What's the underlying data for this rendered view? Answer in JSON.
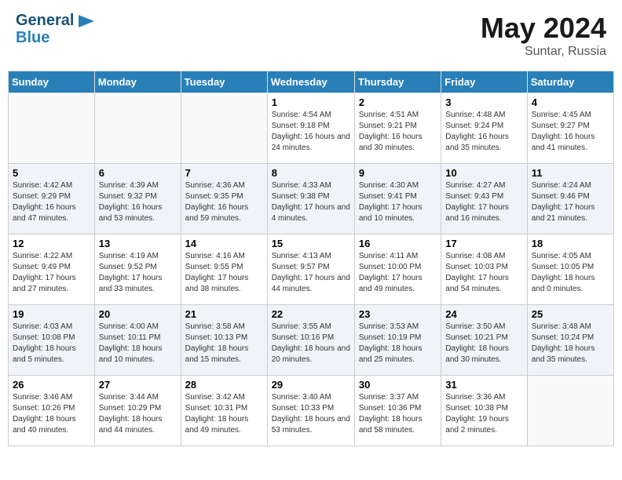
{
  "header": {
    "logo_line1": "General",
    "logo_line2": "Blue",
    "month": "May 2024",
    "location": "Suntar, Russia"
  },
  "days_of_week": [
    "Sunday",
    "Monday",
    "Tuesday",
    "Wednesday",
    "Thursday",
    "Friday",
    "Saturday"
  ],
  "weeks": [
    [
      {
        "num": "",
        "info": ""
      },
      {
        "num": "",
        "info": ""
      },
      {
        "num": "",
        "info": ""
      },
      {
        "num": "1",
        "info": "Sunrise: 4:54 AM\nSunset: 9:18 PM\nDaylight: 16 hours\nand 24 minutes."
      },
      {
        "num": "2",
        "info": "Sunrise: 4:51 AM\nSunset: 9:21 PM\nDaylight: 16 hours\nand 30 minutes."
      },
      {
        "num": "3",
        "info": "Sunrise: 4:48 AM\nSunset: 9:24 PM\nDaylight: 16 hours\nand 35 minutes."
      },
      {
        "num": "4",
        "info": "Sunrise: 4:45 AM\nSunset: 9:27 PM\nDaylight: 16 hours\nand 41 minutes."
      }
    ],
    [
      {
        "num": "5",
        "info": "Sunrise: 4:42 AM\nSunset: 9:29 PM\nDaylight: 16 hours\nand 47 minutes."
      },
      {
        "num": "6",
        "info": "Sunrise: 4:39 AM\nSunset: 9:32 PM\nDaylight: 16 hours\nand 53 minutes."
      },
      {
        "num": "7",
        "info": "Sunrise: 4:36 AM\nSunset: 9:35 PM\nDaylight: 16 hours\nand 59 minutes."
      },
      {
        "num": "8",
        "info": "Sunrise: 4:33 AM\nSunset: 9:38 PM\nDaylight: 17 hours\nand 4 minutes."
      },
      {
        "num": "9",
        "info": "Sunrise: 4:30 AM\nSunset: 9:41 PM\nDaylight: 17 hours\nand 10 minutes."
      },
      {
        "num": "10",
        "info": "Sunrise: 4:27 AM\nSunset: 9:43 PM\nDaylight: 17 hours\nand 16 minutes."
      },
      {
        "num": "11",
        "info": "Sunrise: 4:24 AM\nSunset: 9:46 PM\nDaylight: 17 hours\nand 21 minutes."
      }
    ],
    [
      {
        "num": "12",
        "info": "Sunrise: 4:22 AM\nSunset: 9:49 PM\nDaylight: 17 hours\nand 27 minutes."
      },
      {
        "num": "13",
        "info": "Sunrise: 4:19 AM\nSunset: 9:52 PM\nDaylight: 17 hours\nand 33 minutes."
      },
      {
        "num": "14",
        "info": "Sunrise: 4:16 AM\nSunset: 9:55 PM\nDaylight: 17 hours\nand 38 minutes."
      },
      {
        "num": "15",
        "info": "Sunrise: 4:13 AM\nSunset: 9:57 PM\nDaylight: 17 hours\nand 44 minutes."
      },
      {
        "num": "16",
        "info": "Sunrise: 4:11 AM\nSunset: 10:00 PM\nDaylight: 17 hours\nand 49 minutes."
      },
      {
        "num": "17",
        "info": "Sunrise: 4:08 AM\nSunset: 10:03 PM\nDaylight: 17 hours\nand 54 minutes."
      },
      {
        "num": "18",
        "info": "Sunrise: 4:05 AM\nSunset: 10:05 PM\nDaylight: 18 hours\nand 0 minutes."
      }
    ],
    [
      {
        "num": "19",
        "info": "Sunrise: 4:03 AM\nSunset: 10:08 PM\nDaylight: 18 hours\nand 5 minutes."
      },
      {
        "num": "20",
        "info": "Sunrise: 4:00 AM\nSunset: 10:11 PM\nDaylight: 18 hours\nand 10 minutes."
      },
      {
        "num": "21",
        "info": "Sunrise: 3:58 AM\nSunset: 10:13 PM\nDaylight: 18 hours\nand 15 minutes."
      },
      {
        "num": "22",
        "info": "Sunrise: 3:55 AM\nSunset: 10:16 PM\nDaylight: 18 hours\nand 20 minutes."
      },
      {
        "num": "23",
        "info": "Sunrise: 3:53 AM\nSunset: 10:19 PM\nDaylight: 18 hours\nand 25 minutes."
      },
      {
        "num": "24",
        "info": "Sunrise: 3:50 AM\nSunset: 10:21 PM\nDaylight: 18 hours\nand 30 minutes."
      },
      {
        "num": "25",
        "info": "Sunrise: 3:48 AM\nSunset: 10:24 PM\nDaylight: 18 hours\nand 35 minutes."
      }
    ],
    [
      {
        "num": "26",
        "info": "Sunrise: 3:46 AM\nSunset: 10:26 PM\nDaylight: 18 hours\nand 40 minutes."
      },
      {
        "num": "27",
        "info": "Sunrise: 3:44 AM\nSunset: 10:29 PM\nDaylight: 18 hours\nand 44 minutes."
      },
      {
        "num": "28",
        "info": "Sunrise: 3:42 AM\nSunset: 10:31 PM\nDaylight: 18 hours\nand 49 minutes."
      },
      {
        "num": "29",
        "info": "Sunrise: 3:40 AM\nSunset: 10:33 PM\nDaylight: 18 hours\nand 53 minutes."
      },
      {
        "num": "30",
        "info": "Sunrise: 3:37 AM\nSunset: 10:36 PM\nDaylight: 18 hours\nand 58 minutes."
      },
      {
        "num": "31",
        "info": "Sunrise: 3:36 AM\nSunset: 10:38 PM\nDaylight: 19 hours\nand 2 minutes."
      },
      {
        "num": "",
        "info": ""
      }
    ]
  ]
}
